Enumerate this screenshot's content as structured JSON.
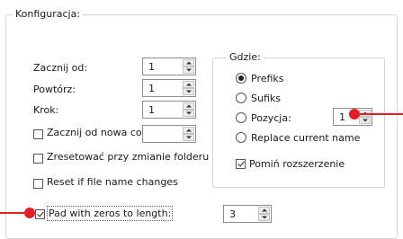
{
  "group": {
    "title": "Konfiguracja:"
  },
  "fields": {
    "start_label": "Zacznij od:",
    "start_value": "1",
    "repeat_label": "Powtórz:",
    "repeat_value": "1",
    "step_label": "Krok:",
    "step_value": "1",
    "restart_label": "Zacznij od nowa co:",
    "restart_value": ""
  },
  "checkboxes": {
    "reset_on_folder_change": "Zresetować przy zmianie folderu",
    "reset_on_name_change": "Reset if file name changes",
    "pad_with_zeros": "Pad with zeros to length:",
    "pad_value": "3"
  },
  "where": {
    "title": "Gdzie:",
    "prefix": "Prefiks",
    "suffix": "Sufiks",
    "position": "Pozycja:",
    "position_value": "1",
    "replace": "Replace current name",
    "skip_extension": "Pomiń rozszerzenie"
  },
  "states": {
    "restart_checked": false,
    "reset_on_folder_change_checked": false,
    "reset_on_name_change_checked": false,
    "pad_with_zeros_checked": true,
    "where_selected": "prefix",
    "skip_extension_checked": true
  },
  "colors": {
    "marker": "#e31e24"
  }
}
